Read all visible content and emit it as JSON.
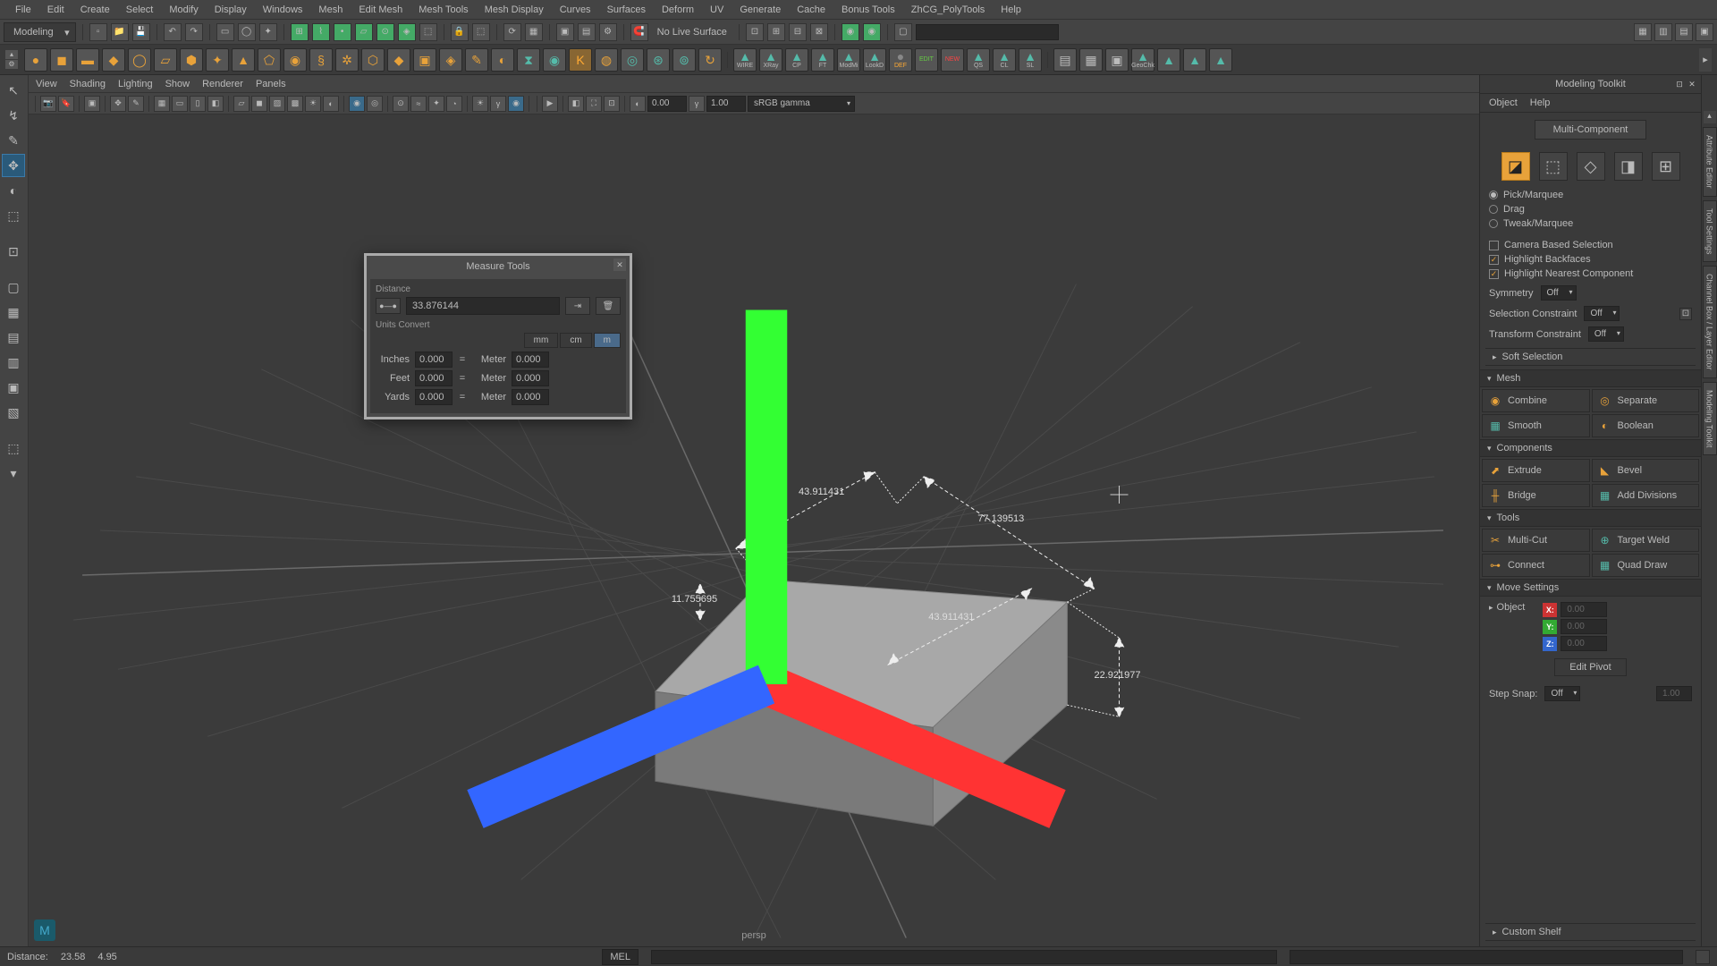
{
  "menubar": [
    "File",
    "Edit",
    "Create",
    "Select",
    "Modify",
    "Display",
    "Windows",
    "Mesh",
    "Edit Mesh",
    "Mesh Tools",
    "Mesh Display",
    "Curves",
    "Surfaces",
    "Deform",
    "UV",
    "Generate",
    "Cache",
    "Bonus Tools",
    "ZhCG_PolyTools",
    "Help"
  ],
  "workspace": {
    "mode": "Modeling",
    "noLiveSurface": "No Live Surface"
  },
  "shelf_right": [
    "WIRE",
    "XRay",
    "CP",
    "FT",
    "ModMi",
    "LookD",
    "DEF",
    "EDIT",
    "NEW",
    "QS",
    "CL",
    "SL",
    "",
    "",
    "",
    "GeoChk"
  ],
  "panel_menu": [
    "View",
    "Shading",
    "Lighting",
    "Show",
    "Renderer",
    "Panels"
  ],
  "panel_toolbar": {
    "val1": "0.00",
    "val2": "1.00",
    "gamma": "sRGB gamma"
  },
  "viewport": {
    "camera": "persp",
    "dims": {
      "d1": "43.911431",
      "d2": "77.139513",
      "d3": "11.755695",
      "d4": "43.911431",
      "d5": "22.921977"
    }
  },
  "modal": {
    "title": "Measure Tools",
    "sec1": "Distance",
    "distance": "33.876144",
    "sec2": "Units Convert",
    "units": [
      "mm",
      "cm",
      "m"
    ],
    "rows": [
      {
        "l": "Inches",
        "v1": "0.000",
        "r": "Meter",
        "v2": "0.000"
      },
      {
        "l": "Feet",
        "v1": "0.000",
        "r": "Meter",
        "v2": "0.000"
      },
      {
        "l": "Yards",
        "v1": "0.000",
        "r": "Meter",
        "v2": "0.000"
      }
    ]
  },
  "toolkit": {
    "title": "Modeling Toolkit",
    "menu": [
      "Object",
      "Help"
    ],
    "multiComp": "Multi-Component",
    "selmodes": [
      "Pick/Marquee",
      "Drag",
      "Tweak/Marquee"
    ],
    "checks": [
      "Camera Based Selection",
      "Highlight Backfaces",
      "Highlight Nearest Component"
    ],
    "symmetry": {
      "l": "Symmetry",
      "v": "Off"
    },
    "selcon": {
      "l": "Selection Constraint",
      "v": "Off"
    },
    "xformcon": {
      "l": "Transform Constraint",
      "v": "Off"
    },
    "soft": "Soft Selection",
    "sec_mesh": "Mesh",
    "mesh_btns": [
      "Combine",
      "Separate",
      "Smooth",
      "Boolean"
    ],
    "sec_comp": "Components",
    "comp_btns": [
      "Extrude",
      "Bevel",
      "Bridge",
      "Add Divisions"
    ],
    "sec_tools": "Tools",
    "tool_btns": [
      "Multi-Cut",
      "Target Weld",
      "Connect",
      "Quad Draw"
    ],
    "sec_move": "Move Settings",
    "objmode": "Object",
    "axes": {
      "x": "0.00",
      "y": "0.00",
      "z": "0.00"
    },
    "editPivot": "Edit Pivot",
    "stepSnap": {
      "l": "Step Snap:",
      "v": "Off",
      "n": "1.00"
    },
    "shelf": "Custom Shelf"
  },
  "vtabs": [
    "Attribute Editor",
    "Tool Settings",
    "Channel Box / Layer Editor",
    "Modeling Toolkit"
  ],
  "status": {
    "label": "Distance:",
    "v1": "23.58",
    "v2": "4.95",
    "mel": "MEL"
  }
}
